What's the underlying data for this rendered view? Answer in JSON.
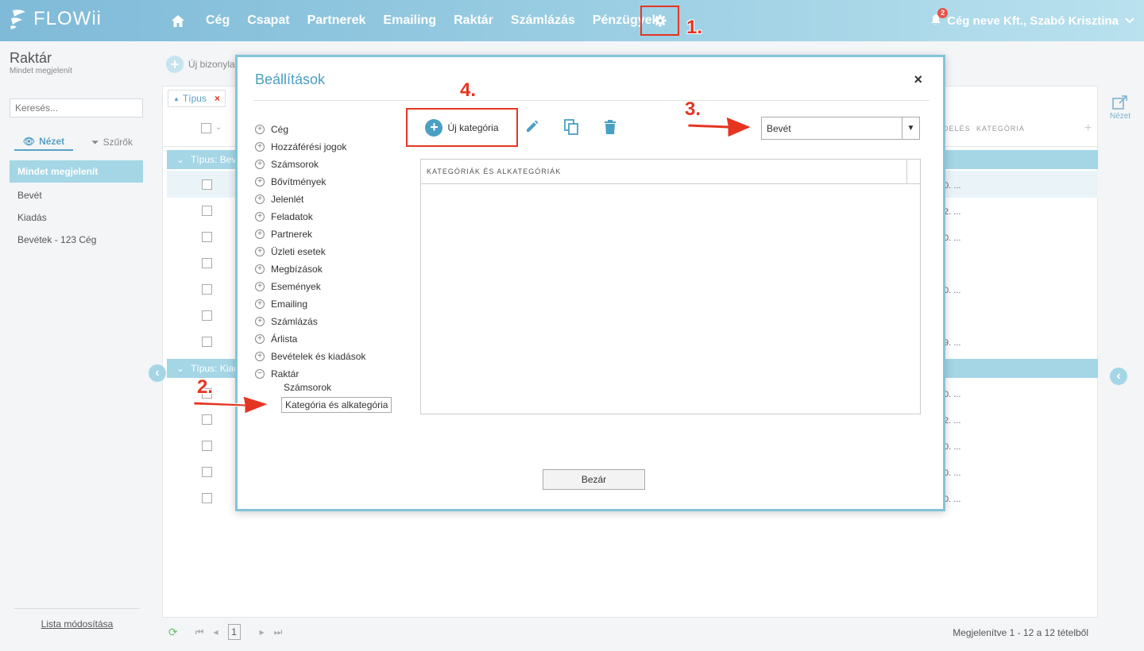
{
  "topnav": {
    "logo": "FLOWii",
    "menu": [
      "Cég",
      "Csapat",
      "Partnerek",
      "Emailing",
      "Raktár",
      "Számlázás",
      "Pénzügyek"
    ],
    "notification_count": "2",
    "user": "Cég neve Kft., Szabó Krisztina"
  },
  "annotations": [
    "1.",
    "2.",
    "3.",
    "4."
  ],
  "sidebar": {
    "title": "Raktár",
    "subtitle": "Mindet megjelenít",
    "search_placeholder": "Keresés...",
    "tabs": [
      "Nézet",
      "Szűrők"
    ],
    "items": [
      "Mindet megjelenít",
      "Bevét",
      "Kiadás",
      "Bevétek - 123 Cég"
    ],
    "footer": "Lista módosítása"
  },
  "toolbar": {
    "new_doc": "Új bizonyla"
  },
  "grid": {
    "filter_chip": "Típus",
    "columns": [
      "DELÉS",
      "KATEGÓRIA"
    ],
    "groups": [
      "Típus: Beve",
      "Típus: Kiad"
    ],
    "cell_fragments": [
      "0. ...",
      "2. ...",
      "0. ...",
      "",
      "0. ...",
      "",
      "9. ...",
      "0. ...",
      "2. ...",
      "0. ...",
      "0. ...",
      "0. ..."
    ]
  },
  "right_panel": {
    "label": "Nézet"
  },
  "pager": {
    "page": "1",
    "info": "Megjelenítve 1 - 12 a 12 tételből"
  },
  "modal": {
    "title": "Beállítások",
    "tree": [
      "Cég",
      "Hozzáférési jogok",
      "Számsorok",
      "Bővítmények",
      "Jelenlét",
      "Feladatok",
      "Partnerek",
      "Üzleti esetek",
      "Megbízások",
      "Események",
      "Emailing",
      "Számlázás",
      "Árlista",
      "Bevételek és kiadások",
      "Raktár"
    ],
    "subitems": [
      "Számsorok",
      "Kategória és alkategória"
    ],
    "new_category": "Új kategória",
    "select_value": "Bevét",
    "table_header": "KATEGÓRIÁK ÉS ALKATEGÓRIÁK",
    "close_button": "Bezár"
  }
}
